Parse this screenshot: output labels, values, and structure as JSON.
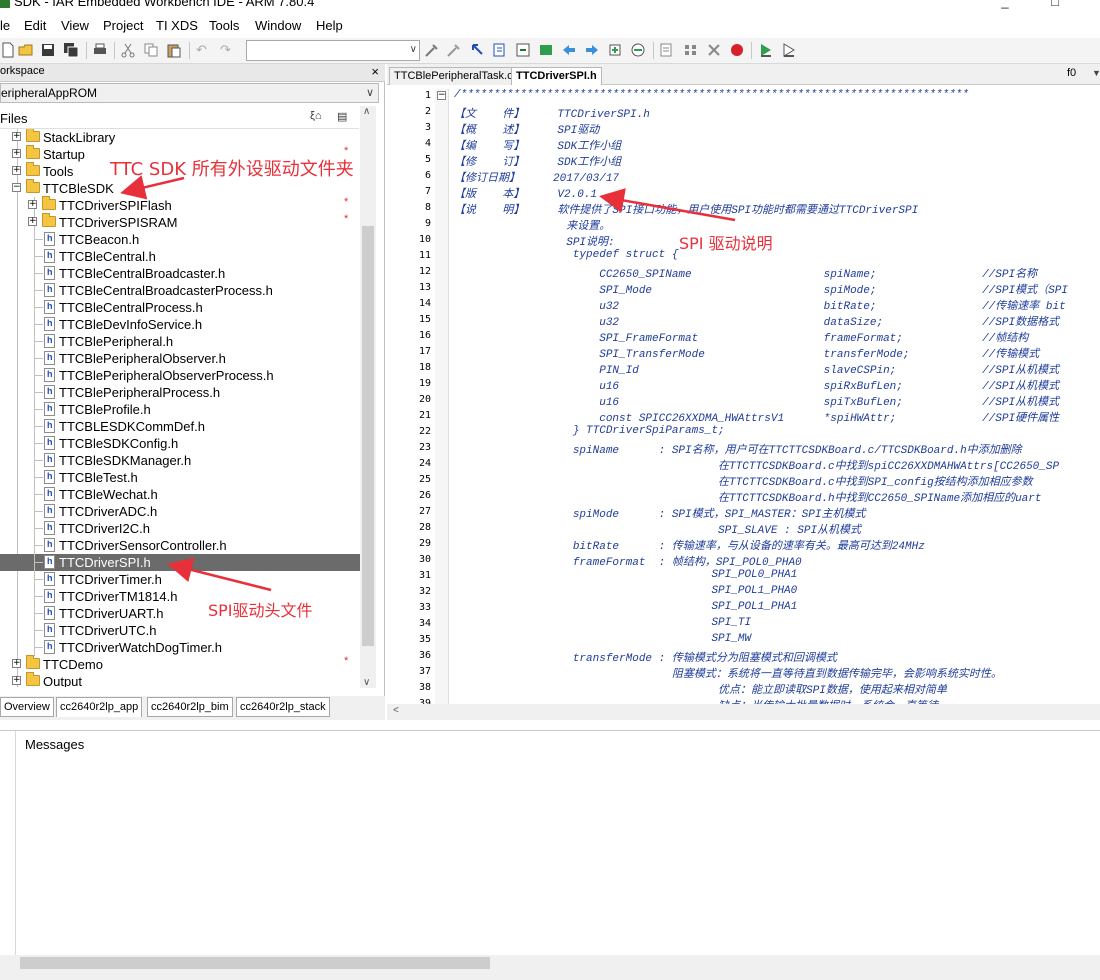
{
  "window": {
    "title": "SDK - IAR Embedded Workbench IDE - ARM 7.80.4"
  },
  "menu": [
    "le",
    "Edit",
    "View",
    "Project",
    "TI XDS",
    "Tools",
    "Window",
    "Help"
  ],
  "workspace": {
    "header": "orkspace",
    "config": "eripheralAppROM",
    "files_label": "Files",
    "tabs": [
      "Overview",
      "cc2640r2lp_app",
      "cc2640r2lp_bim",
      "cc2640r2lp_stack"
    ],
    "tree": [
      {
        "label": "StackLibrary",
        "kind": "folder",
        "level": 1,
        "pm": "+",
        "star": false
      },
      {
        "label": "Startup",
        "kind": "folder",
        "level": 1,
        "pm": "+",
        "star": true
      },
      {
        "label": "Tools",
        "kind": "folder",
        "level": 1,
        "pm": "+",
        "star": false
      },
      {
        "label": "TTCBleSDK",
        "kind": "folder",
        "level": 1,
        "pm": "−",
        "star": false
      },
      {
        "label": "TTCDriverSPIFlash",
        "kind": "folder",
        "level": 2,
        "pm": "+",
        "star": true
      },
      {
        "label": "TTCDriverSPISRAM",
        "kind": "folder",
        "level": 2,
        "pm": "+",
        "star": true
      },
      {
        "label": "TTCBeacon.h",
        "kind": "file",
        "level": 2
      },
      {
        "label": "TTCBleCentral.h",
        "kind": "file",
        "level": 2
      },
      {
        "label": "TTCBleCentralBroadcaster.h",
        "kind": "file",
        "level": 2
      },
      {
        "label": "TTCBleCentralBroadcasterProcess.h",
        "kind": "file",
        "level": 2
      },
      {
        "label": "TTCBleCentralProcess.h",
        "kind": "file",
        "level": 2
      },
      {
        "label": "TTCBleDevInfoService.h",
        "kind": "file",
        "level": 2
      },
      {
        "label": "TTCBlePeripheral.h",
        "kind": "file",
        "level": 2
      },
      {
        "label": "TTCBlePeripheralObserver.h",
        "kind": "file",
        "level": 2
      },
      {
        "label": "TTCBlePeripheralObserverProcess.h",
        "kind": "file",
        "level": 2
      },
      {
        "label": "TTCBlePeripheralProcess.h",
        "kind": "file",
        "level": 2
      },
      {
        "label": "TTCBleProfile.h",
        "kind": "file",
        "level": 2
      },
      {
        "label": "TTCBLESDKCommDef.h",
        "kind": "file",
        "level": 2
      },
      {
        "label": "TTCBleSDKConfig.h",
        "kind": "file",
        "level": 2
      },
      {
        "label": "TTCBleSDKManager.h",
        "kind": "file",
        "level": 2
      },
      {
        "label": "TTCBleTest.h",
        "kind": "file",
        "level": 2
      },
      {
        "label": "TTCBleWechat.h",
        "kind": "file",
        "level": 2
      },
      {
        "label": "TTCDriverADC.h",
        "kind": "file",
        "level": 2
      },
      {
        "label": "TTCDriverI2C.h",
        "kind": "file",
        "level": 2
      },
      {
        "label": "TTCDriverSensorController.h",
        "kind": "file",
        "level": 2
      },
      {
        "label": "TTCDriverSPI.h",
        "kind": "file",
        "level": 2,
        "selected": true
      },
      {
        "label": "TTCDriverTimer.h",
        "kind": "file",
        "level": 2
      },
      {
        "label": "TTCDriverTM1814.h",
        "kind": "file",
        "level": 2
      },
      {
        "label": "TTCDriverUART.h",
        "kind": "file",
        "level": 2
      },
      {
        "label": "TTCDriverUTC.h",
        "kind": "file",
        "level": 2
      },
      {
        "label": "TTCDriverWatchDogTimer.h",
        "kind": "file",
        "level": 2
      },
      {
        "label": "TTCDemo",
        "kind": "folder",
        "level": 1,
        "pm": "+",
        "star": true
      },
      {
        "label": "Output",
        "kind": "folder",
        "level": 1,
        "pm": "+",
        "star": false
      }
    ]
  },
  "editor": {
    "tabs": [
      "TTCBlePeripheralTask.c",
      "TTCDriverSPI.h"
    ],
    "active_tab": "TTCDriverSPI.h",
    "function": "f0",
    "lines": [
      "/*****************************************************************************",
      "【文    件】     TTCDriverSPI.h",
      "【概    述】     SPI驱动",
      "【编    写】     SDK工作小组",
      "【修    订】     SDK工作小组",
      "【修订日期】     2017/03/17",
      "【版    本】     V2.0.1",
      "【说    明】     软件提供了SPI接口功能，用户使用SPI功能时都需要通过TTCDriverSPI",
      "                 来设置。",
      "                 SPI说明:",
      "                  typedef struct {",
      "                      CC2650_SPIName                    spiName;                //SPI名称",
      "                      SPI_Mode                          spiMode;                //SPI模式（SPI",
      "                      u32                               bitRate;                //传输速率 bit",
      "                      u32                               dataSize;               //SPI数据格式",
      "                      SPI_FrameFormat                   frameFormat;            //帧结构",
      "                      SPI_TransferMode                  transferMode;           //传输模式",
      "                      PIN_Id                            slaveCSPin;             //SPI从机模式",
      "                      u16                               spiRxBufLen;            //SPI从机模式",
      "                      u16                               spiTxBufLen;            //SPI从机模式",
      "                      const SPICC26XXDMA_HWAttrsV1      *spiHWAttr;             //SPI硬件属性",
      "                  } TTCDriverSpiParams_t;",
      "                  spiName      : SPI名称，用户可在TTCTTCSDKBoard.c/TTCSDKBoard.h中添加删除",
      "                                        在TTCTTCSDKBoard.c中找到spiCC26XXDMAHWAttrs[CC2650_SP",
      "                                        在TTCTTCSDKBoard.c中找到SPI_config按结构添加相应参数",
      "                                        在TTCTTCSDKBoard.h中找到CC2650_SPIName添加相应的uart",
      "                  spiMode      : SPI模式，SPI_MASTER：SPI主机模式",
      "                                        SPI_SLAVE : SPI从机模式",
      "                  bitRate      : 传输速率，与从设备的速率有关。最高可达到24MHz",
      "                  frameFormat  : 帧结构，SPI_POL0_PHA0",
      "                                       SPI_POL0_PHA1",
      "                                       SPI_POL1_PHA0",
      "                                       SPI_POL1_PHA1",
      "                                       SPI_TI",
      "                                       SPI_MW",
      "                  transferMode : 传输模式分为阻塞模式和回调模式",
      "                                 阻塞模式：系统将一直等待直到数据传输完毕，会影响系统实时性。",
      "                                        优点：能立即读取SPI数据，使用起来相对简单",
      "                                        缺点：当传输大批量数据时，系统会一直等待"
    ]
  },
  "messages": {
    "label": "Messages"
  },
  "annotations": {
    "sdk_folder": "TTC SDK 所有外设驱动文件夹",
    "spi_desc": "SPI 驱动说明",
    "spi_header": "SPI驱动头文件"
  },
  "colors": {
    "annotation": "#e8303a",
    "code": "#1f3d9a",
    "selected_row": "#6b6b6b",
    "folder": "#f4c542"
  }
}
